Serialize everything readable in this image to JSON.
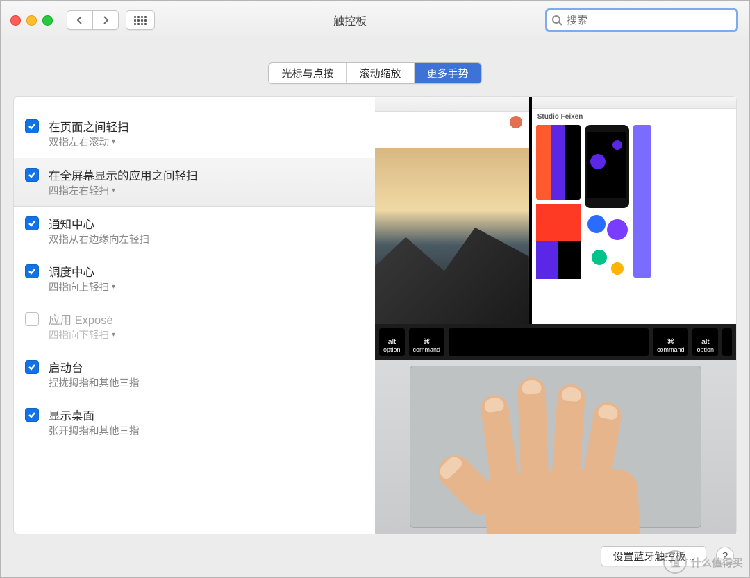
{
  "window": {
    "title": "触控板"
  },
  "search": {
    "placeholder": "搜索"
  },
  "tabs": [
    {
      "label": "光标与点按",
      "selected": false
    },
    {
      "label": "滚动缩放",
      "selected": false
    },
    {
      "label": "更多手势",
      "selected": true
    }
  ],
  "options": [
    {
      "checked": true,
      "title": "在页面之间轻扫",
      "sub": "双指左右滚动",
      "dropdown": true,
      "selected": false,
      "disabled": false
    },
    {
      "checked": true,
      "title": "在全屏幕显示的应用之间轻扫",
      "sub": "四指左右轻扫",
      "dropdown": true,
      "selected": true,
      "disabled": false
    },
    {
      "checked": true,
      "title": "通知中心",
      "sub": "双指从右边缘向左轻扫",
      "dropdown": false,
      "selected": false,
      "disabled": false
    },
    {
      "checked": true,
      "title": "调度中心",
      "sub": "四指向上轻扫",
      "dropdown": true,
      "selected": false,
      "disabled": false
    },
    {
      "checked": false,
      "title": "应用 Exposé",
      "sub": "四指向下轻扫",
      "dropdown": true,
      "selected": false,
      "disabled": true
    },
    {
      "checked": true,
      "title": "启动台",
      "sub": "捏拢拇指和其他三指",
      "dropdown": false,
      "selected": false,
      "disabled": false
    },
    {
      "checked": true,
      "title": "显示桌面",
      "sub": "张开拇指和其他三指",
      "dropdown": false,
      "selected": false,
      "disabled": false
    }
  ],
  "preview": {
    "design_header": "Studio Feixen",
    "keys_left": [
      "alt option",
      "⌘ command"
    ],
    "keys_right": [
      "⌘ command",
      "alt option"
    ]
  },
  "footer": {
    "bluetooth": "设置蓝牙触控板..."
  },
  "watermark": {
    "badge": "值",
    "text": "什么值得买"
  }
}
